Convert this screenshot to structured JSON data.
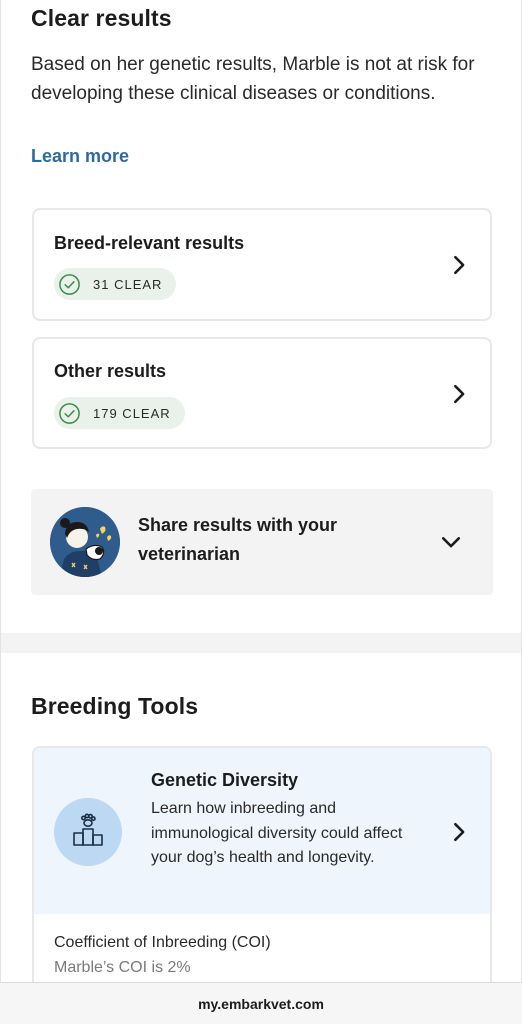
{
  "clear_results": {
    "title": "Clear results",
    "description": "Based on her genetic results, Marble is not at risk for developing these clinical diseases or conditions.",
    "learn_more": "Learn more",
    "cards": [
      {
        "title": "Breed-relevant results",
        "badge": "31 CLEAR"
      },
      {
        "title": "Other results",
        "badge": "179 CLEAR"
      }
    ]
  },
  "share": {
    "text": "Share results with your veterinarian"
  },
  "breeding_tools": {
    "title": "Breeding Tools",
    "genetic_diversity": {
      "title": "Genetic Diversity",
      "description": "Learn how inbreeding and immunological diversity could affect your dog’s health and longevity.",
      "coi_label": "Coefficient of Inbreeding (COI)",
      "coi_value": "Marble’s COI is 2%"
    }
  },
  "browser": {
    "url": "my.embarkvet.com"
  },
  "colors": {
    "link": "#2d6aa3",
    "badge_bg": "#e9f1ea",
    "check": "#3c8f4b",
    "card_highlight": "#eef5fc",
    "icon_circle": "#bcd8f3"
  },
  "icons": [
    "check-circle-icon",
    "chevron-right-icon",
    "chevron-down-icon",
    "veterinarian-avatar",
    "paw-podium-icon"
  ]
}
